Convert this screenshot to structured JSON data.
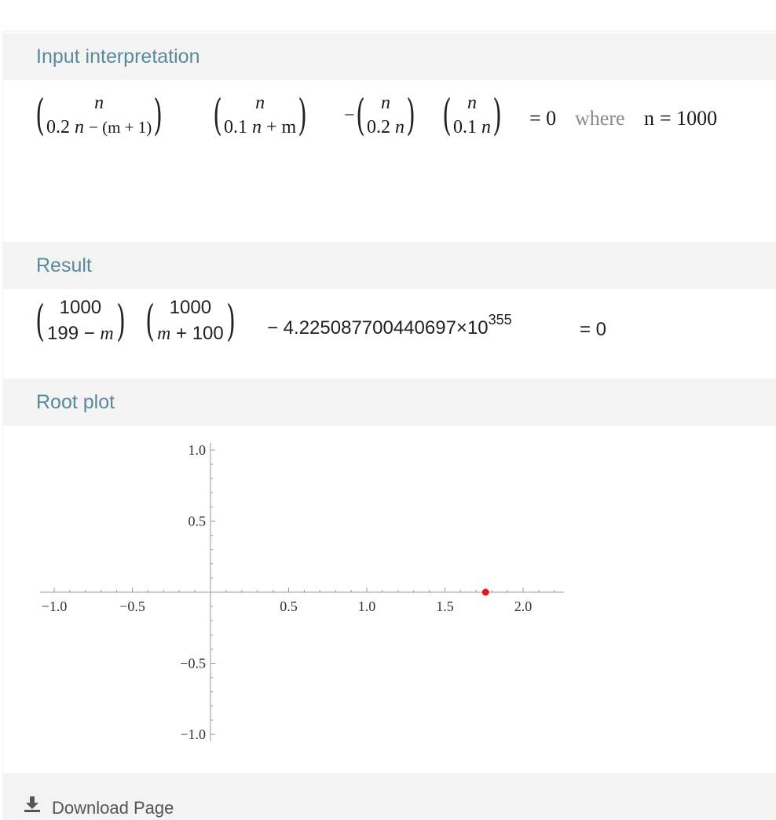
{
  "pods": {
    "input": {
      "title": "Input interpretation",
      "binoms": [
        {
          "top": "n",
          "bottom_num": "0.2",
          "bottom_var": "n",
          "bottom_rest": "− (m + 1)"
        },
        {
          "top": "n",
          "bottom_num": "0.1",
          "bottom_var": "n",
          "bottom_rest": "+ m"
        },
        {
          "top": "n",
          "bottom_num": "0.2",
          "bottom_var": "n",
          "bottom_rest": ""
        },
        {
          "top": "n",
          "bottom_num": "0.1",
          "bottom_var": "n",
          "bottom_rest": ""
        }
      ],
      "minus": "−",
      "equals": "= 0",
      "where": "where",
      "var": "n",
      "var_value": "= 1000"
    },
    "result": {
      "title": "Result",
      "binom1": {
        "top": "1000",
        "bottom_num": "199 −",
        "bottom_var": "m"
      },
      "binom2": {
        "top": "1000",
        "bottom_var": "m",
        "bottom_rest": "+ 100"
      },
      "tail_main": "− 4.225087700440697",
      "times": "×",
      "base": "10",
      "exponent": "355",
      "equals": "= 0"
    },
    "root_plot": {
      "title": "Root plot"
    }
  },
  "download": {
    "label": "Download Page",
    "icon": "download-icon"
  },
  "colors": {
    "header_text": "#5a8a9a",
    "header_bg": "#f3f3f3",
    "root_point": "#e8141a",
    "axis": "#9a9a9a"
  },
  "chart_data": {
    "type": "scatter",
    "title": "",
    "xlabel": "",
    "ylabel": "",
    "xlim": [
      -1.05,
      2.25
    ],
    "ylim": [
      -1.05,
      1.05
    ],
    "x_ticks": [
      -1.0,
      -0.5,
      0.5,
      1.0,
      1.5,
      2.0
    ],
    "x_tick_labels": [
      "−1.0",
      "−0.5",
      "0.5",
      "1.0",
      "1.5",
      "2.0"
    ],
    "y_ticks": [
      1.0,
      0.5,
      -0.5,
      -1.0
    ],
    "y_tick_labels": [
      "1.0",
      "0.5",
      "−0.5",
      "−1.0"
    ],
    "grid": false,
    "series": [
      {
        "points": [
          {
            "x": 1.76,
            "y": 0
          }
        ],
        "color": "#e8141a"
      }
    ]
  }
}
